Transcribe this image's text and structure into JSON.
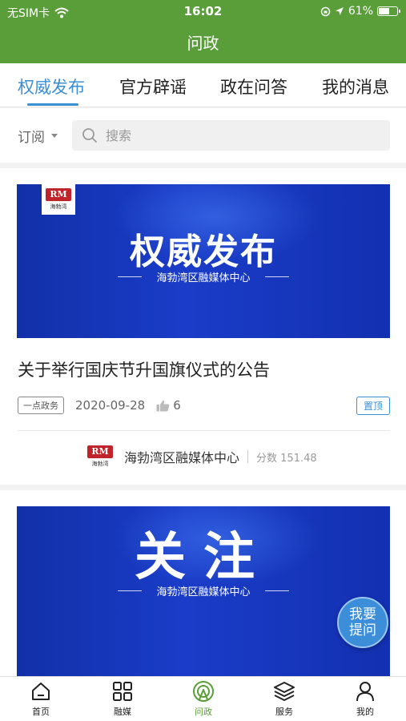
{
  "status_bar": {
    "carrier": "无SIM卡",
    "time": "16:02",
    "battery": "61%",
    "battery_level": 0.61,
    "icons": [
      "wifi-icon",
      "orientation-lock-icon",
      "location-icon",
      "battery-icon"
    ]
  },
  "header": {
    "title": "问政"
  },
  "tabs": [
    {
      "label": "权威发布",
      "active": true
    },
    {
      "label": "官方辟谣",
      "active": false
    },
    {
      "label": "政在问答",
      "active": false
    },
    {
      "label": "我的消息",
      "active": false
    }
  ],
  "filter": {
    "subscribe_label": "订阅",
    "search_placeholder": "搜索"
  },
  "posts": [
    {
      "banner_title": "权威发布",
      "banner_subtitle": "海勃湾区融媒体中心",
      "logo_text": "RM",
      "logo_caption": "海勃湾",
      "headline": "关于举行国庆节升国旗仪式的公告",
      "tag": "一点政务",
      "date": "2020-09-28",
      "likes": "6",
      "pin_label": "置顶",
      "source_name": "海勃湾区融媒体中心",
      "score": "分数 151.48"
    },
    {
      "banner_title": "关注",
      "banner_subtitle": "海勃湾区融媒体中心"
    }
  ],
  "fab": {
    "line1": "我要",
    "line2": "提问"
  },
  "bottom_nav": [
    {
      "label": "首页",
      "icon": "home-icon",
      "active": false
    },
    {
      "label": "融媒",
      "icon": "grid-icon",
      "active": false
    },
    {
      "label": "问政",
      "icon": "broadcast-icon",
      "active": true
    },
    {
      "label": "服务",
      "icon": "layers-icon",
      "active": false
    },
    {
      "label": "我的",
      "icon": "user-icon",
      "active": false
    }
  ],
  "colors": {
    "header": "#5a9e3a",
    "accent": "#3a8fd6",
    "banner": "#1a3cc8"
  }
}
